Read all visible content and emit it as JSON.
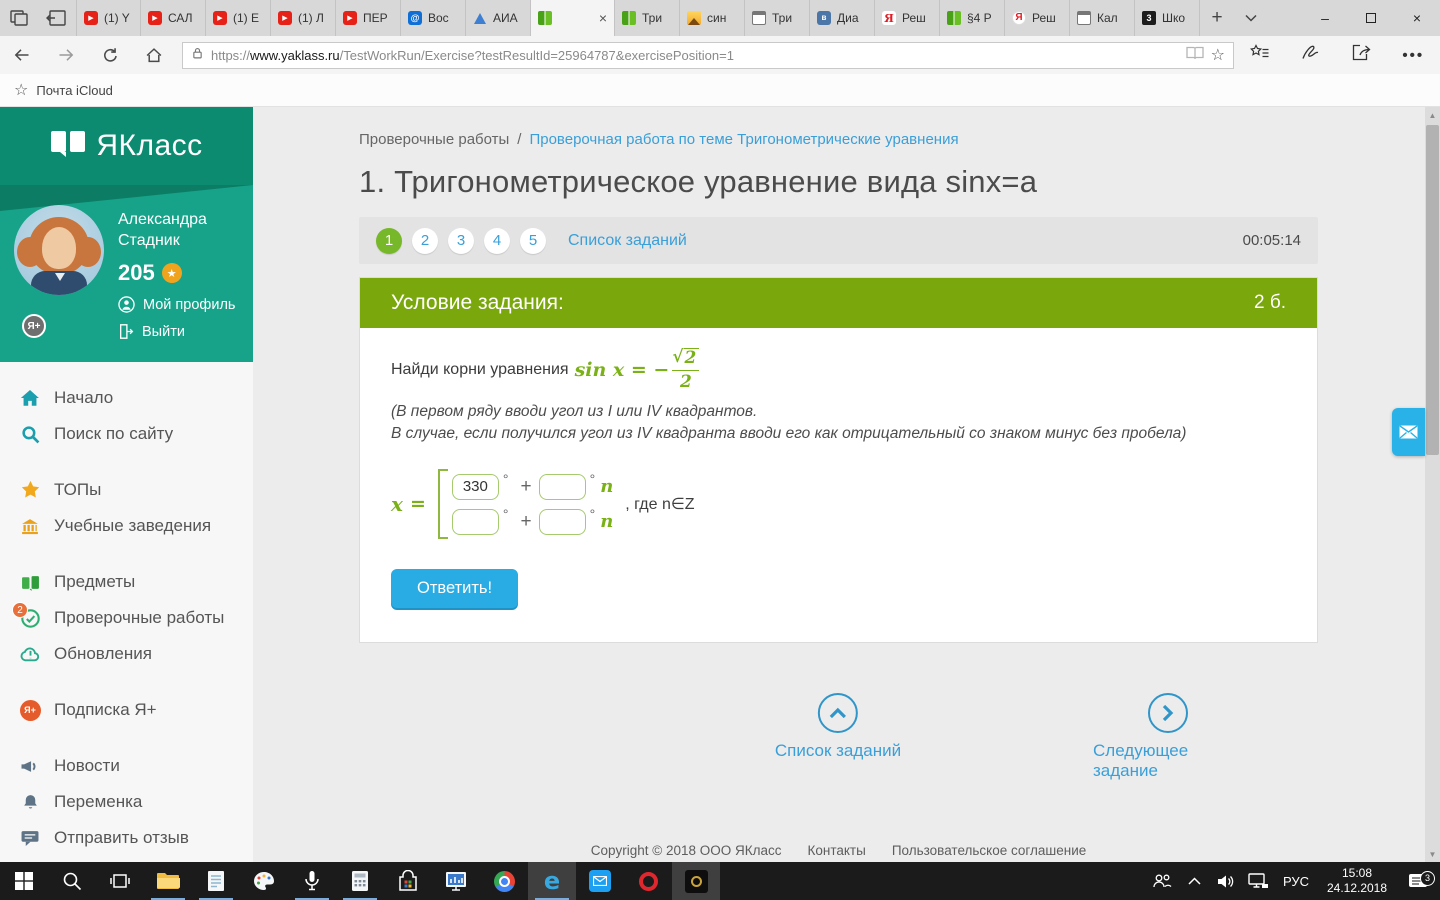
{
  "browser": {
    "icons": {
      "newtab": "+",
      "minimize": "–",
      "close": "×",
      "tabclose": "×",
      "play": "▶",
      "star": "☆",
      "dots": "•••",
      "at": "@",
      "vk": "в",
      "ya": "Я",
      "school3": "3",
      "up_arrow": "▲",
      "down_arrow": "▼"
    },
    "tabs": [
      {
        "icon": "youtube",
        "label": "(1) Y"
      },
      {
        "icon": "youtube",
        "label": "САЛ"
      },
      {
        "icon": "youtube",
        "label": "(1) Е"
      },
      {
        "icon": "youtube",
        "label": "(1) Л"
      },
      {
        "icon": "youtube",
        "label": "ПЕР"
      },
      {
        "icon": "mailru",
        "label": "Вос"
      },
      {
        "icon": "aia-triangle",
        "label": "АИА"
      },
      {
        "icon": "yaklass-book",
        "label": "",
        "active": true
      },
      {
        "icon": "yaklass-book",
        "label": "Три"
      },
      {
        "icon": "image",
        "label": "син"
      },
      {
        "icon": "window",
        "label": "Три"
      },
      {
        "icon": "vk",
        "label": "Диа"
      },
      {
        "icon": "yandex",
        "label": "Реш"
      },
      {
        "icon": "yaklass-book",
        "label": "§4 Р"
      },
      {
        "icon": "yandex-browser",
        "label": "Реш"
      },
      {
        "icon": "window",
        "label": "Кал"
      },
      {
        "icon": "school",
        "label": "Шко"
      }
    ],
    "url": {
      "prefix": "https://",
      "domain": "www.yaklass.ru",
      "path": "/TestWorkRun/Exercise?testResultId=25964787&exercisePosition=1"
    },
    "bookmark": "Почта iCloud"
  },
  "sidebar": {
    "logo": "ЯКласс",
    "user": {
      "name_line1": "Александра",
      "name_line2": "Стадник",
      "points": "205",
      "badge": "Я+",
      "profile_link": "Мой профиль",
      "logout_link": "Выйти"
    },
    "menu": [
      {
        "icon": "home",
        "label": "Начало"
      },
      {
        "icon": "search",
        "label": "Поиск по сайту"
      },
      {
        "icon": "star",
        "label": "ТОПы"
      },
      {
        "icon": "bank",
        "label": "Учебные заведения"
      },
      {
        "icon": "books",
        "label": "Предметы"
      },
      {
        "icon": "tests",
        "label": "Проверочные работы",
        "badge": "2"
      },
      {
        "icon": "updates",
        "label": "Обновления"
      },
      {
        "icon": "yaplus",
        "label": "Подписка Я+"
      },
      {
        "icon": "news",
        "label": "Новости"
      },
      {
        "icon": "bell",
        "label": "Переменка"
      },
      {
        "icon": "feedback",
        "label": "Отправить отзыв"
      }
    ]
  },
  "main": {
    "breadcrumb": {
      "root": "Проверочные работы",
      "sep": "/",
      "current": "Проверочная работа по теме Тригонометрические уравнения"
    },
    "title": "1. Тригонометрическое уравнение вида sinx=a",
    "tasknav": {
      "numbers": [
        "1",
        "2",
        "3",
        "4",
        "5"
      ],
      "active": "1",
      "list_label": "Список заданий",
      "timer": "00:05:14"
    },
    "task": {
      "header": "Условие задания:",
      "points": "2 б.",
      "prompt": "Найди корни уравнения",
      "math": {
        "sin": "sin x = −",
        "radical": "√",
        "radicand": "2",
        "denominator": "2"
      },
      "note1": "(В первом ряду вводи угол из I или IV квадрантов.",
      "note2": "В случае, если получился угол из IV квадранта вводи его как отрицательный со знаком минус без пробела)",
      "answer": {
        "x": "x",
        "eq": "=",
        "value1": "330",
        "deg": "°",
        "plus": "+",
        "n": "n",
        "where": ",  где n∈Z"
      },
      "submit": "Ответить!"
    },
    "bottomnav": {
      "list": "Список заданий",
      "next": "Следующее задание"
    },
    "footer": {
      "copyright": "Copyright © 2018 ООО ЯКласс",
      "contacts": "Контакты",
      "agreement": "Пользовательское соглашение"
    }
  },
  "taskbar": {
    "lang": "РУС",
    "time": "15:08",
    "date": "24.12.2018",
    "notif_count": "3"
  }
}
